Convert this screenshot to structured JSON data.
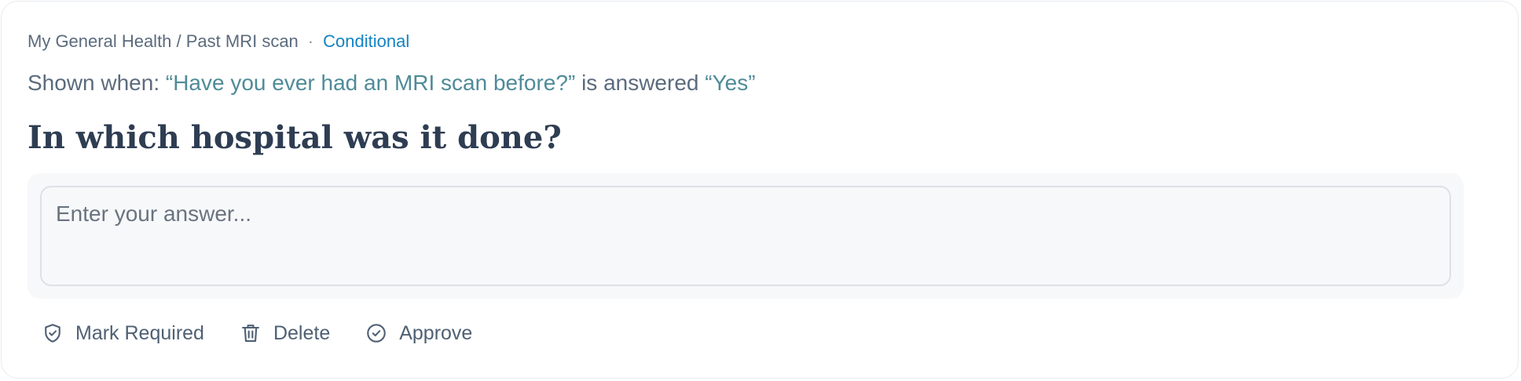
{
  "breadcrumb": {
    "path": "My General Health / Past MRI scan",
    "separator": "·",
    "tag": "Conditional"
  },
  "condition": {
    "lead": "Shown when:",
    "question": "“Have you ever had an MRI scan before?”",
    "middle": "is answered",
    "answer": "“Yes”"
  },
  "question": {
    "title": "In which hospital was it done?",
    "placeholder": "Enter your answer...",
    "value": ""
  },
  "actions": {
    "mark_required": {
      "label": "Mark Required",
      "icon": "shield-check-icon"
    },
    "delete": {
      "label": "Delete",
      "icon": "trash-icon"
    },
    "approve": {
      "label": "Approve",
      "icon": "check-circle-icon"
    }
  },
  "colors": {
    "tag": "#1483c3",
    "condition_highlight": "#4f8b98",
    "title": "#2e3d52",
    "muted": "#5b6b7d"
  }
}
